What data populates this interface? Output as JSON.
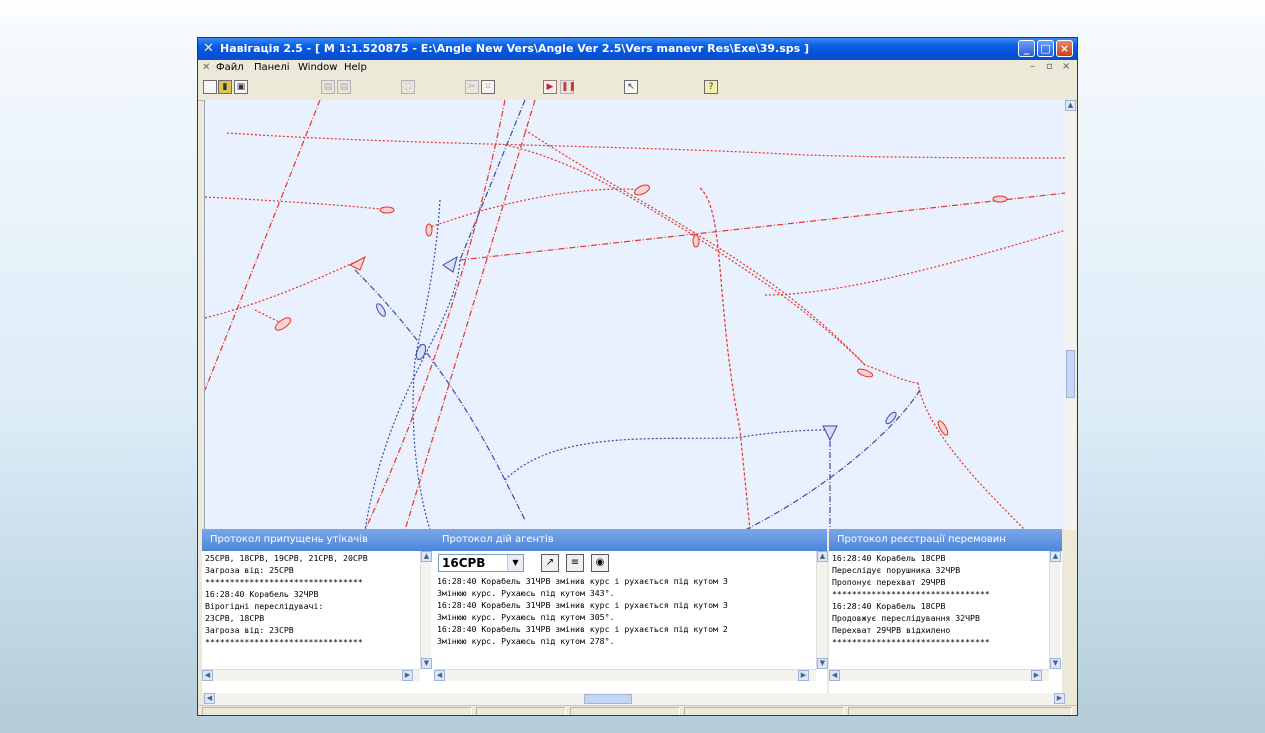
{
  "window": {
    "title": "Навігація 2.5 - [   M 1:1.520875 - E:\\Angle New Vers\\Angle Ver 2.5\\Vers manevr Res\\Exe\\39.sps   ]",
    "controls": {
      "minimize": "_",
      "maximize": "□",
      "close": "×"
    }
  },
  "menu": {
    "items": [
      "Файл",
      "Панелі",
      "Window",
      "Help"
    ],
    "mdi_controls": {
      "minimize": "–",
      "restore": "▫",
      "close": "×"
    }
  },
  "toolbar": {
    "icons": [
      "new-file-icon",
      "open-file-icon",
      "save-icon",
      "copy-icon",
      "paste-icon",
      "fit-icon",
      "scissors-icon",
      "chart-icon",
      "play-icon",
      "pause-icon",
      "pointer-icon",
      "help-icon"
    ]
  },
  "panels": {
    "escape": {
      "title": "Протокол припущень утікачів",
      "log": "25СРВ, 18СРВ, 19СРВ, 21СРВ, 20СРВ\nЗагроза від: 25СРВ\n********************************\n16:28:40 Корабель 32ЧРВ\nВірогідні переслідувачі:\n23СРВ, 18СРВ\nЗагроза від: 23СРВ\n********************************"
    },
    "agents": {
      "title": "Протокол дій агентів",
      "selected_agent": "16СРВ",
      "log": "16:28:40 Корабель 31ЧРВ змінив курс і рухається під кутом 3\nЗмінюю курс. Рухаюсь під кутом 343°.\n16:28:40 Корабель 31ЧРВ змінив курс і рухається під кутом 3\nЗмінюю курс. Рухаюсь під кутом 305°.\n16:28:40 Корабель 31ЧРВ змінив курс і рухається під кутом 2\nЗмінюю курс. Рухаюсь під кутом 278°."
    },
    "registration": {
      "title": "Протокол реєстрації перемовин",
      "log": "16:28:40 Корабель 18СРВ\nПереслідує порушника 32ЧРВ\nПропонує перехват 29ЧРВ\n********************************\n16:28:40 Корабель 18СРВ\nПродовжує переслідування 32ЧРВ\nПерехват 29ЧРВ відхилено\n********************************"
    }
  },
  "colors": {
    "red_track": "#e8322a",
    "blue_track": "#3a4ea8",
    "map_bg": "#e8f1fd",
    "titlebar": "#0a5ae0",
    "panel_title": "#5c8fdc"
  }
}
